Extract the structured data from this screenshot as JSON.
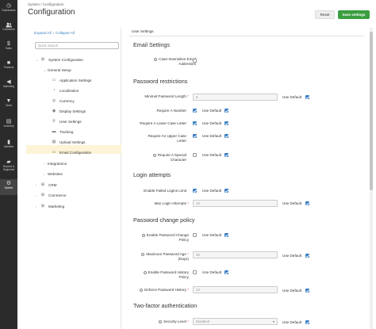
{
  "nav": [
    {
      "label": "Dashboards",
      "icon": "dashboard-icon",
      "glyph": "◷"
    },
    {
      "label": "Customers",
      "icon": "customers-icon",
      "glyph": "👥"
    },
    {
      "label": "Sales",
      "icon": "sales-icon",
      "glyph": "$"
    },
    {
      "label": "Products",
      "icon": "products-icon",
      "glyph": "■"
    },
    {
      "label": "Marketing",
      "icon": "marketing-icon",
      "glyph": "◀"
    },
    {
      "label": "Taxes",
      "icon": "taxes-icon",
      "glyph": "▼"
    },
    {
      "label": "Inventory",
      "icon": "inventory-icon",
      "glyph": "▤"
    },
    {
      "label": "Activities",
      "icon": "activities-icon",
      "glyph": "▮"
    },
    {
      "label": "Reports & Segments",
      "icon": "reports-icon",
      "glyph": "▰"
    },
    {
      "label": "System",
      "icon": "system-icon",
      "glyph": "⚙"
    }
  ],
  "header": {
    "breadcrumb": "System / Configuration",
    "title": "Configuration",
    "reset_label": "Reset",
    "save_label": "Save settings"
  },
  "tree": {
    "expand_all": "Expand All",
    "collapse_all": "Collapse All",
    "search_placeholder": "Quick Search",
    "items": [
      {
        "label": "System Configuration",
        "arrow": "⌄",
        "glyph": "⊞"
      },
      {
        "label": "General Setup",
        "arrow": "⌄",
        "glyph": ""
      },
      {
        "label": "Application Settings",
        "arrow": "",
        "glyph": "▭"
      },
      {
        "label": "Localization",
        "arrow": "",
        "glyph": "◔"
      },
      {
        "label": "Currency",
        "arrow": "",
        "glyph": "◎"
      },
      {
        "label": "Display Settings",
        "arrow": "",
        "glyph": "◉"
      },
      {
        "label": "User Settings",
        "arrow": "",
        "glyph": "⚲"
      },
      {
        "label": "Tracking",
        "arrow": "",
        "glyph": "▬"
      },
      {
        "label": "Upload Settings",
        "arrow": "",
        "glyph": "▤"
      },
      {
        "label": "Email Configuration",
        "arrow": "",
        "glyph": "▭"
      },
      {
        "label": "Integrations",
        "arrow": "›",
        "glyph": ""
      },
      {
        "label": "Websites",
        "arrow": "›",
        "glyph": ""
      },
      {
        "label": "CRM",
        "arrow": "›",
        "glyph": "⊞"
      },
      {
        "label": "Commerce",
        "arrow": "›",
        "glyph": "⊞"
      },
      {
        "label": "Marketing",
        "arrow": "›",
        "glyph": "⊞"
      }
    ]
  },
  "main": {
    "title": "User Settings",
    "use_default": "Use Default",
    "sections": {
      "email": "Email Settings",
      "password": "Password restrictions",
      "login": "Login attempts",
      "change": "Password change policy",
      "twofa": "Two-factor authentication"
    },
    "fields": {
      "case_insensitive_1": "Case-Insensitive Email",
      "case_insensitive_2": "Addresses",
      "min_length": "Minimal Password Length",
      "min_length_value": "8",
      "req_number": "Require A Number",
      "req_lower_1": "Require A Lower Case Letter",
      "req_upper_1": "Require An Upper Case",
      "req_upper_2": "Letter",
      "req_special_1": "Require A Special",
      "req_special_2": "Character",
      "failed_logins": "Enable Failed Logins Limit",
      "max_attempts": "Max Login Attempts",
      "max_attempts_value": "10",
      "enable_change_1": "Enable Password Change",
      "enable_change_2": "Policy",
      "max_age_1": "Maximum Password Age",
      "max_age_2": "(Days)",
      "max_age_value": "30",
      "enable_history_1": "Enable Password History",
      "enable_history_2": "Policy",
      "enforce_history": "Enforce Password History",
      "enforce_history_value": "12",
      "security_level": "Security Level",
      "security_level_value": "Disabled"
    }
  }
}
